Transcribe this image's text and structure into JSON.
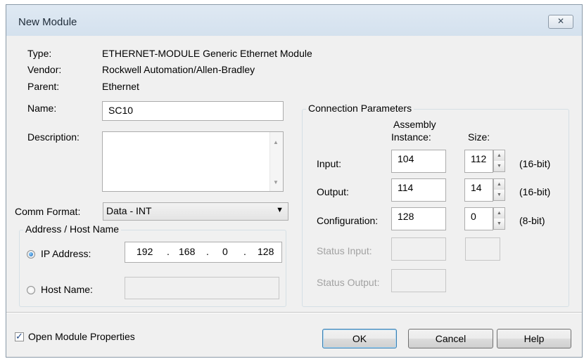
{
  "window": {
    "title": "New Module",
    "close_icon": "close-icon"
  },
  "info": {
    "type_label": "Type:",
    "type_value": "ETHERNET-MODULE Generic Ethernet Module",
    "vendor_label": "Vendor:",
    "vendor_value": "Rockwell Automation/Allen-Bradley",
    "parent_label": "Parent:",
    "parent_value": "Ethernet",
    "name_label": "Name:",
    "name_value": "SC10",
    "description_label": "Description:",
    "description_value": ""
  },
  "comm_format": {
    "label": "Comm Format:",
    "value": "Data - INT"
  },
  "address": {
    "group_title": "Address / Host Name",
    "ip_label": "IP Address:",
    "ip_selected": true,
    "ip_octets": [
      "192",
      "168",
      "0",
      "128"
    ],
    "ip_dots": [
      ".",
      ".",
      "."
    ],
    "host_label": "Host Name:",
    "host_value": ""
  },
  "connection": {
    "group_title": "Connection Parameters",
    "assembly_header_1": "Assembly",
    "assembly_header_2": "Instance:",
    "size_header": "Size:",
    "rows": [
      {
        "label": "Input:",
        "instance": "104",
        "size": "112",
        "unit": "(16-bit)"
      },
      {
        "label": "Output:",
        "instance": "114",
        "size": "14",
        "unit": "(16-bit)"
      },
      {
        "label": "Configuration:",
        "instance": "128",
        "size": "0",
        "unit": "(8-bit)"
      }
    ],
    "status_input_label": "Status Input:",
    "status_output_label": "Status Output:"
  },
  "footer": {
    "open_props_label": "Open Module Properties",
    "open_props_checked": true,
    "ok_label": "OK",
    "cancel_label": "Cancel",
    "help_label": "Help"
  }
}
